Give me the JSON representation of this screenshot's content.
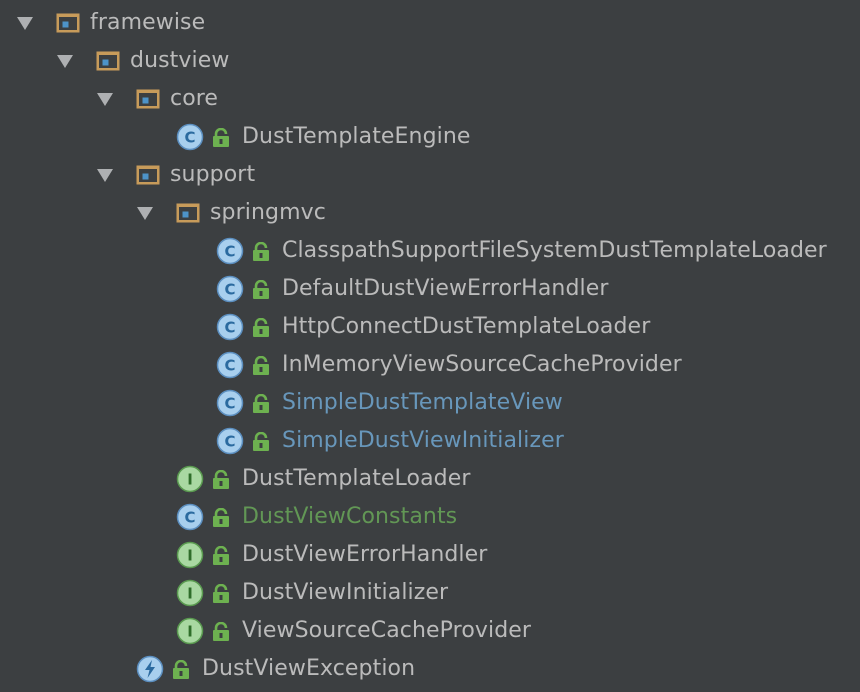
{
  "tree": {
    "framewise": {
      "label": "framewise"
    },
    "dustview": {
      "label": "dustview"
    },
    "core": {
      "label": "core"
    },
    "dust_template_engine": {
      "label": "DustTemplateEngine",
      "icon": "class-icon"
    },
    "support": {
      "label": "support"
    },
    "springmvc": {
      "label": "springmvc"
    },
    "classpath_loader": {
      "label": "ClasspathSupportFileSystemDustTemplateLoader",
      "icon": "class-icon"
    },
    "default_error_handler": {
      "label": "DefaultDustViewErrorHandler",
      "icon": "class-icon"
    },
    "http_connect_loader": {
      "label": "HttpConnectDustTemplateLoader",
      "icon": "class-icon"
    },
    "in_memory_cache_provider": {
      "label": "InMemoryViewSourceCacheProvider",
      "icon": "class-icon"
    },
    "simple_template_view": {
      "label": "SimpleDustTemplateView",
      "icon": "class-icon",
      "status": "modified"
    },
    "simple_view_initializer": {
      "label": "SimpleDustViewInitializer",
      "icon": "class-icon",
      "status": "modified"
    },
    "dust_template_loader": {
      "label": "DustTemplateLoader",
      "icon": "interface-icon"
    },
    "dust_view_constants": {
      "label": "DustViewConstants",
      "icon": "class-icon",
      "status": "added"
    },
    "dust_view_error_handler": {
      "label": "DustViewErrorHandler",
      "icon": "interface-icon"
    },
    "dust_view_initializer": {
      "label": "DustViewInitializer",
      "icon": "interface-icon"
    },
    "view_source_cache_provider": {
      "label": "ViewSourceCacheProvider",
      "icon": "interface-icon"
    },
    "dust_view_exception": {
      "label": "DustViewException",
      "icon": "exception-icon"
    }
  },
  "colors": {
    "background": "#3c3f41",
    "text": "#bbbbbb",
    "modified": "#6897bb",
    "added": "#629755",
    "class_icon_fill": "#a8cfee",
    "interface_icon_fill": "#a9d8a2",
    "folder": "#c79b5a",
    "lock": "#6db150"
  }
}
